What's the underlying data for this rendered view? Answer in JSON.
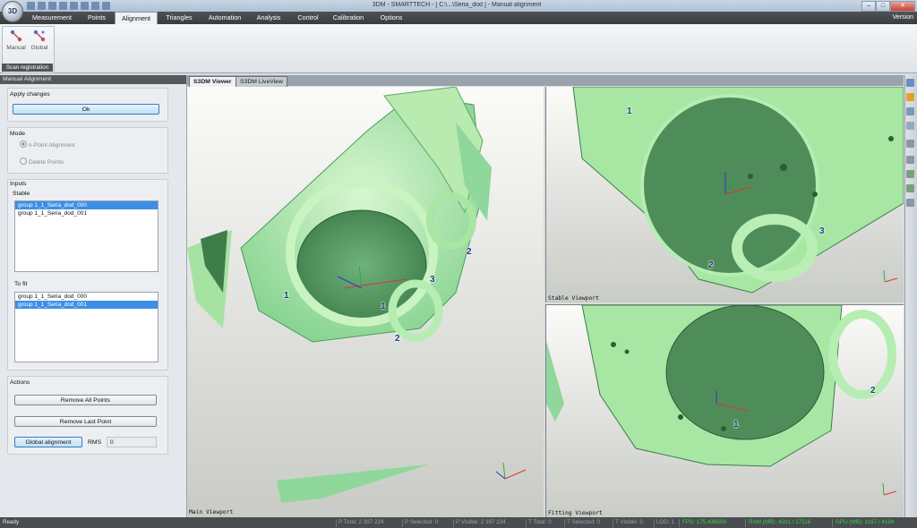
{
  "window": {
    "title": "3DM - SMARTTECH  - [ C:\\...\\Seria_dod ] - Manual alignment",
    "version_label": "Version",
    "controls": [
      "–",
      "□",
      "✕"
    ]
  },
  "menu": {
    "tabs": [
      "Measurement",
      "Points",
      "Alignment",
      "Triangles",
      "Automation",
      "Analysis",
      "Control",
      "Calibration",
      "Options"
    ],
    "active_tab": "Alignment"
  },
  "ribbon": {
    "group_label": "Scan registration",
    "buttons": [
      "Manual",
      "Global"
    ]
  },
  "panel": {
    "title": "Manual Alignment",
    "apply_label": "Apply changes",
    "ok_label": "Ok",
    "mode_label": "Mode",
    "mode_options": [
      "n-Point Alignment",
      "Delete Points"
    ],
    "inputs_label": "Inputs",
    "stable_label": "Stable",
    "stable_items": [
      "group 1_1_Seria_dod_000",
      "group 1_1_Seria_dod_001"
    ],
    "stable_selected": 0,
    "tofit_label": "To fit",
    "tofit_items": [
      "group 1_1_Seria_dod_000",
      "group 1_1_Seria_dod_001"
    ],
    "tofit_selected": 1,
    "actions_label": "Actions",
    "remove_all_label": "Remove All Points",
    "remove_last_label": "Remove Last Point",
    "global_label": "Global alignment",
    "rms_label": "RMS",
    "rms_value": "0"
  },
  "viewer": {
    "tabs": [
      "S3DM Viewer",
      "S3DM LiveView"
    ],
    "main_label": "Main Viewport",
    "stable_label": "Stable Viewport",
    "fitting_label": "Fitting Viewport",
    "markers": {
      "one": "1",
      "two": "2",
      "three": "3"
    }
  },
  "status": {
    "ready": "Ready",
    "p_total": "P Total: 2 397 224",
    "p_selected": "P Selected: 0",
    "p_visible": "P Visible: 2 397 224",
    "t_total": "T Total: 0",
    "t_selected": "T Selected: 0",
    "t_visible": "T Visible: 0",
    "lod": "LOD: 1",
    "fps": "FPS: 175.438599",
    "ram": "RAM (MB): 4201 / 17116",
    "gpu": "GPU (MB): 1167 / 4194"
  },
  "colors": {
    "scan_green": "#9fe0a0",
    "scan_dark": "#4e9a5b",
    "selection_blue": "#3d8ee6",
    "fps_green": "#39d24a"
  }
}
